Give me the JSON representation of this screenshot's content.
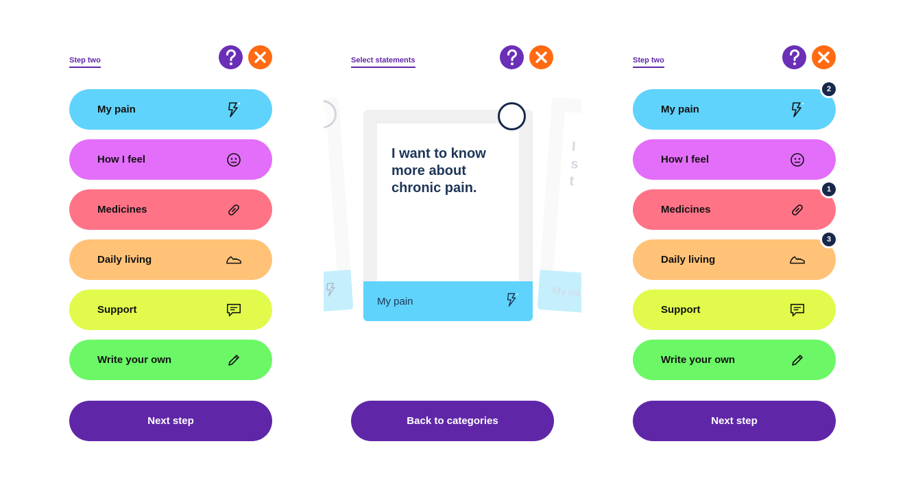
{
  "left": {
    "breadcrumb": "Step two",
    "categories": [
      {
        "label": "My pain",
        "icon": "lightning-icon",
        "color": "#5fd3fb"
      },
      {
        "label": "How I feel",
        "icon": "face-icon",
        "color": "#e36ef9"
      },
      {
        "label": "Medicines",
        "icon": "pill-icon",
        "color": "#ff7387"
      },
      {
        "label": "Daily living",
        "icon": "shoe-icon",
        "color": "#ffc277"
      },
      {
        "label": "Support",
        "icon": "speech-bubble-icon",
        "color": "#e2fa4b"
      },
      {
        "label": "Write your own",
        "icon": "pencil-icon",
        "color": "#6bf766"
      }
    ],
    "cta": "Next step"
  },
  "middle": {
    "breadcrumb": "Select statements",
    "card": {
      "statement": "I want to know more about chronic pain.",
      "category": "My pain"
    },
    "peek_right": {
      "statement_fragment": "I\ns\nt",
      "category_fragment": "My pa"
    },
    "cta": "Back to categories"
  },
  "right": {
    "breadcrumb": "Step two",
    "categories": [
      {
        "label": "My pain",
        "badge": "2"
      },
      {
        "label": "How I feel",
        "badge": ""
      },
      {
        "label": "Medicines",
        "badge": "1"
      },
      {
        "label": "Daily living",
        "badge": "3"
      },
      {
        "label": "Support",
        "badge": ""
      },
      {
        "label": "Write your own",
        "badge": ""
      }
    ],
    "cta": "Next step"
  },
  "colors": {
    "primary": "#5f27a8",
    "help": "#6a2fb6",
    "close": "#ff6a13",
    "badge": "#17284a"
  }
}
